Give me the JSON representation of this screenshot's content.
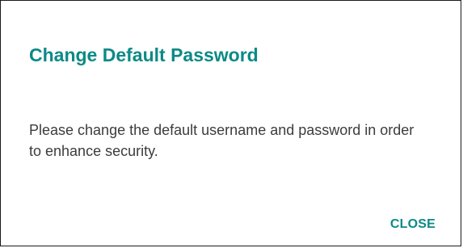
{
  "dialog": {
    "title": "Change Default Password",
    "message": "Please change the default username and password in order to enhance security.",
    "close_label": "CLOSE"
  },
  "colors": {
    "accent": "#0b8a86",
    "text": "#3c3c3c",
    "border": "#1a1a1a",
    "background": "#ffffff"
  }
}
